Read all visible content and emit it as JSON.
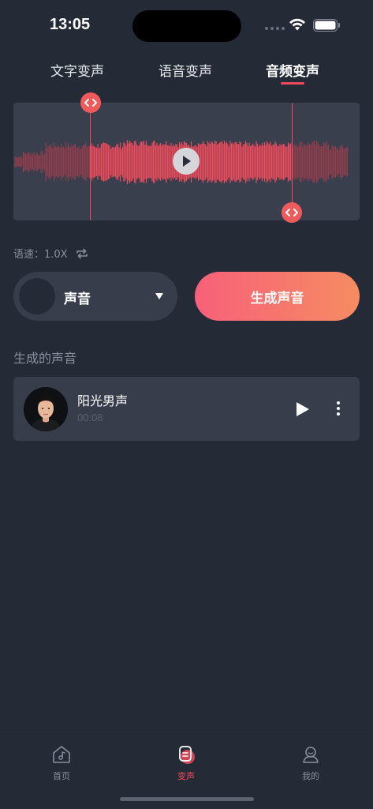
{
  "status_bar": {
    "time": "13:05"
  },
  "tabs": [
    {
      "label": "文字变声",
      "active": false
    },
    {
      "label": "语音变声",
      "active": false
    },
    {
      "label": "音频变声",
      "active": true
    }
  ],
  "waveform": {
    "selection_start": 0.22,
    "selection_end": 0.803,
    "colors": {
      "selected": "#f04b5c",
      "unselected": "#8e3f4e",
      "panel": "#3a3f4d"
    }
  },
  "speed": {
    "label": "语速：1.0X",
    "icon": "repeat-icon"
  },
  "voice_selector": {
    "label": "声音",
    "icon": "caret-down-icon"
  },
  "generate_button": {
    "label": "生成声音"
  },
  "section": {
    "title": "生成的声音"
  },
  "voices": [
    {
      "name": "阳光男声",
      "duration": "00:08",
      "avatar": "young-man-portrait"
    }
  ],
  "bottom_nav": [
    {
      "label": "首页",
      "icon": "music-home-icon",
      "active": false
    },
    {
      "label": "变声",
      "icon": "voice-change-icon",
      "active": true
    },
    {
      "label": "我的",
      "icon": "profile-icon",
      "active": false
    }
  ],
  "colors": {
    "background": "#252a37",
    "accent": "#f04b5c",
    "gradient_start": "#f7607a",
    "gradient_end": "#f68c62",
    "card": "#383d4b",
    "muted_text": "#8b8f9c"
  }
}
